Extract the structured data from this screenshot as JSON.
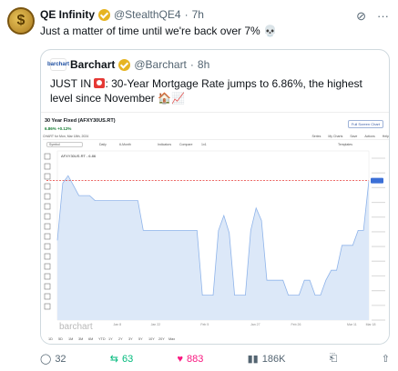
{
  "tweet": {
    "display_name": "QE Infinity",
    "handle": "@StealthQE4",
    "time": "7h",
    "text": "Just a matter of time until we're back over 7% 💀",
    "avatar_symbol": "$"
  },
  "quote": {
    "logo_text": "barchart",
    "display_name": "Barchart",
    "handle": "@Barchart",
    "time": "8h",
    "text_prefix": "JUST IN",
    "text_body": ": 30-Year Mortgage Rate jumps to 6.86%, the highest level since November 🏠📈"
  },
  "screenshot": {
    "title": "30 Year Fixed (AFXY30US.RT)",
    "price": "6.86%",
    "change": "+0.12%",
    "fullscreen_button": "Full Screen Chart",
    "toolbar_left": "CHART for Mon, Mar 18th, 2024",
    "toolbar_right": [
      "Series",
      "My Charts",
      "Save",
      "Actions",
      "Help"
    ],
    "search_placeholder": "Symbol",
    "controls": [
      "Daily",
      "6-Month",
      "Indicators",
      "Compare",
      "1x1"
    ],
    "templates": "Templates",
    "symbol_label": "AFXY30US.RT - 6.86",
    "watermark": "barchart",
    "x_ticks": [
      "Jan 8",
      "Jan 22",
      "Feb 5",
      "Jan 27",
      "Feb 26",
      "Mar 11",
      "Mar 18"
    ],
    "timeframes": [
      "1D",
      "5D",
      "1M",
      "3M",
      "6M",
      "YTD",
      "1Y",
      "2Y",
      "3Y",
      "5Y",
      "10Y",
      "20Y",
      "Max"
    ],
    "line_color": "#8fb4ea",
    "fill_color": "#dce8f8",
    "level_line_color": "#e53935"
  },
  "chart_data": {
    "type": "area",
    "title": "30 Year Fixed (AFXY30US.RT)",
    "series": [
      {
        "name": "AFXY30US.RT",
        "values": [
          6.62,
          6.85,
          6.88,
          6.84,
          6.8,
          6.8,
          6.8,
          6.78,
          6.78,
          6.78,
          6.78,
          6.78,
          6.78,
          6.78,
          6.78,
          6.78,
          6.66,
          6.66,
          6.66,
          6.66,
          6.66,
          6.66,
          6.66,
          6.66,
          6.66,
          6.66,
          6.66,
          6.4,
          6.4,
          6.4,
          6.66,
          6.72,
          6.65,
          6.4,
          6.4,
          6.4,
          6.66,
          6.75,
          6.7,
          6.46,
          6.46,
          6.46,
          6.46,
          6.4,
          6.4,
          6.4,
          6.46,
          6.46,
          6.4,
          6.4,
          6.46,
          6.5,
          6.5,
          6.6,
          6.6,
          6.6,
          6.66,
          6.66,
          6.86
        ]
      }
    ],
    "highlight_level": 6.86,
    "ylim": [
      6.3,
      6.95
    ]
  },
  "actions": {
    "replies": "32",
    "reposts": "63",
    "likes": "883",
    "views": "186K"
  }
}
